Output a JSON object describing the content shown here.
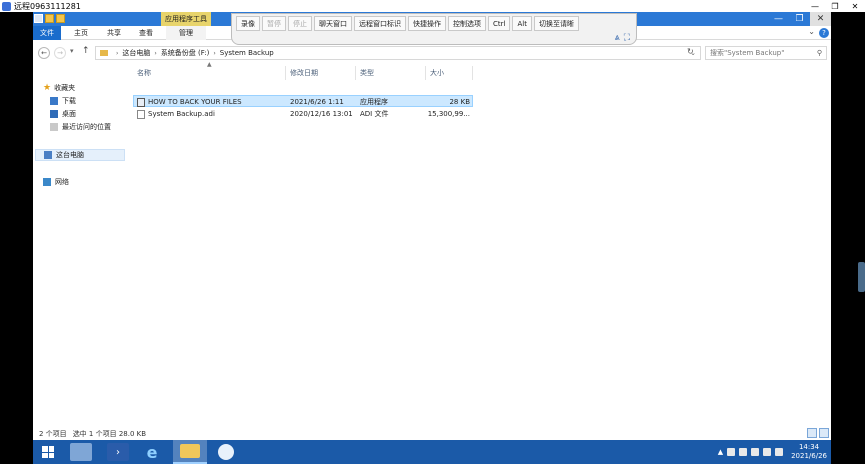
{
  "window": {
    "title": "远程0963111281"
  },
  "ribbon": {
    "context_title": "应用程序工具",
    "tabs": [
      "文件",
      "主页",
      "共享",
      "查看",
      "管理"
    ]
  },
  "remote_toolbar": {
    "buttons": [
      "录像",
      "暂停",
      "停止",
      "聊天窗口",
      "远程窗口标识",
      "快捷操作",
      "控制选项",
      "Ctrl",
      "Alt",
      "切换至请晰"
    ],
    "disabled": [
      "暂停",
      "停止"
    ]
  },
  "address": {
    "crumbs": [
      "这台电脑",
      "系统备份盘 (F:)",
      "System Backup"
    ],
    "search_placeholder": "搜索\"System Backup\""
  },
  "nav_pane": {
    "quick_access": "收藏夹",
    "downloads": "下载",
    "desktop": "桌面",
    "recent": "最近访问的位置",
    "this_pc": "这台电脑",
    "network": "网络"
  },
  "columns": [
    "名称",
    "修改日期",
    "类型",
    "大小"
  ],
  "files": [
    {
      "name": "HOW TO BACK YOUR FILES",
      "date": "2021/6/26 1:11",
      "type": "应用程序",
      "size": "28 KB",
      "icon": "exe-icon"
    },
    {
      "name": "System Backup.adi",
      "date": "2020/12/16 13:01",
      "type": "ADI 文件",
      "size": "15,300,99...",
      "icon": "file-icon"
    }
  ],
  "status": {
    "count": "2 个项目",
    "selected": "选中 1 个项目  28.0 KB"
  },
  "taskbar": {
    "time": "14:34",
    "date": "2021/6/26"
  },
  "colors": {
    "accent": "#2b79d6",
    "taskbar": "#1b5aa8",
    "selection": "#cce8ff"
  }
}
